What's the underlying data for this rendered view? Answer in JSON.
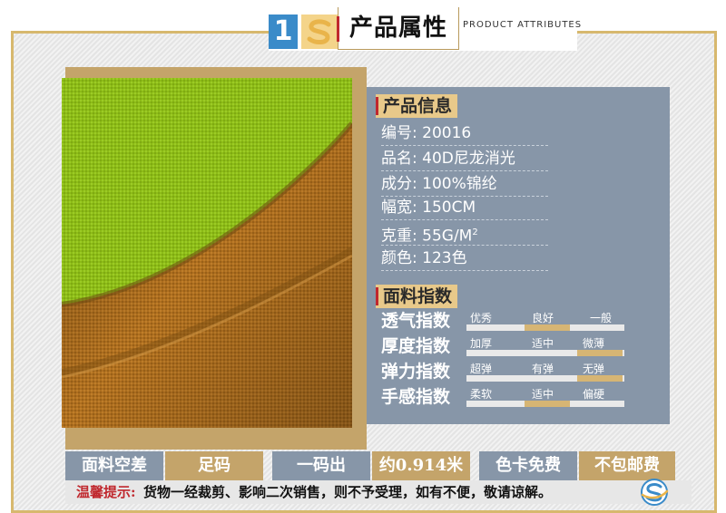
{
  "header": {
    "number": "1",
    "title_cn": "产品属性",
    "title_en": "PRODUCT ATTRIBUTES"
  },
  "info": {
    "heading": "产品信息",
    "rows": [
      {
        "label": "编号:",
        "value": "20016"
      },
      {
        "label": "品名:",
        "value": "40D尼龙消光"
      },
      {
        "label": "成分:",
        "value": "100%锦纶"
      },
      {
        "label": "幅宽:",
        "value": "150CM"
      },
      {
        "label": "克重:",
        "value": "55G/M",
        "sup": "2"
      },
      {
        "label": "颜色:",
        "value": "123色"
      }
    ]
  },
  "index": {
    "heading": "面料指数",
    "rows": [
      {
        "label": "透气指数",
        "options": [
          "优秀",
          "良好",
          "一般"
        ],
        "level": 0.47
      },
      {
        "label": "厚度指数",
        "options": [
          "加厚",
          "适中",
          "微薄"
        ],
        "level": 0.83
      },
      {
        "label": "弹力指数",
        "options": [
          "超弹",
          "有弹",
          "无弹"
        ],
        "level": 0.83
      },
      {
        "label": "手感指数",
        "options": [
          "柔软",
          "适中",
          "偏硬"
        ],
        "level": 0.5
      }
    ]
  },
  "bottom": {
    "cells": [
      "面料空差",
      "足码",
      "一码出",
      "约0.914米",
      "色卡免费",
      "不包邮费"
    ]
  },
  "notice": {
    "label": "温馨提示:",
    "text": "货物一经裁剪、影响二次销售，则不予受理，如有不便，敬请谅解。"
  },
  "colors": {
    "gold": "#c4a46a",
    "slate_blue": "#8796a8",
    "accent_red": "#c0282e",
    "badge_blue": "#3a8bc9"
  }
}
